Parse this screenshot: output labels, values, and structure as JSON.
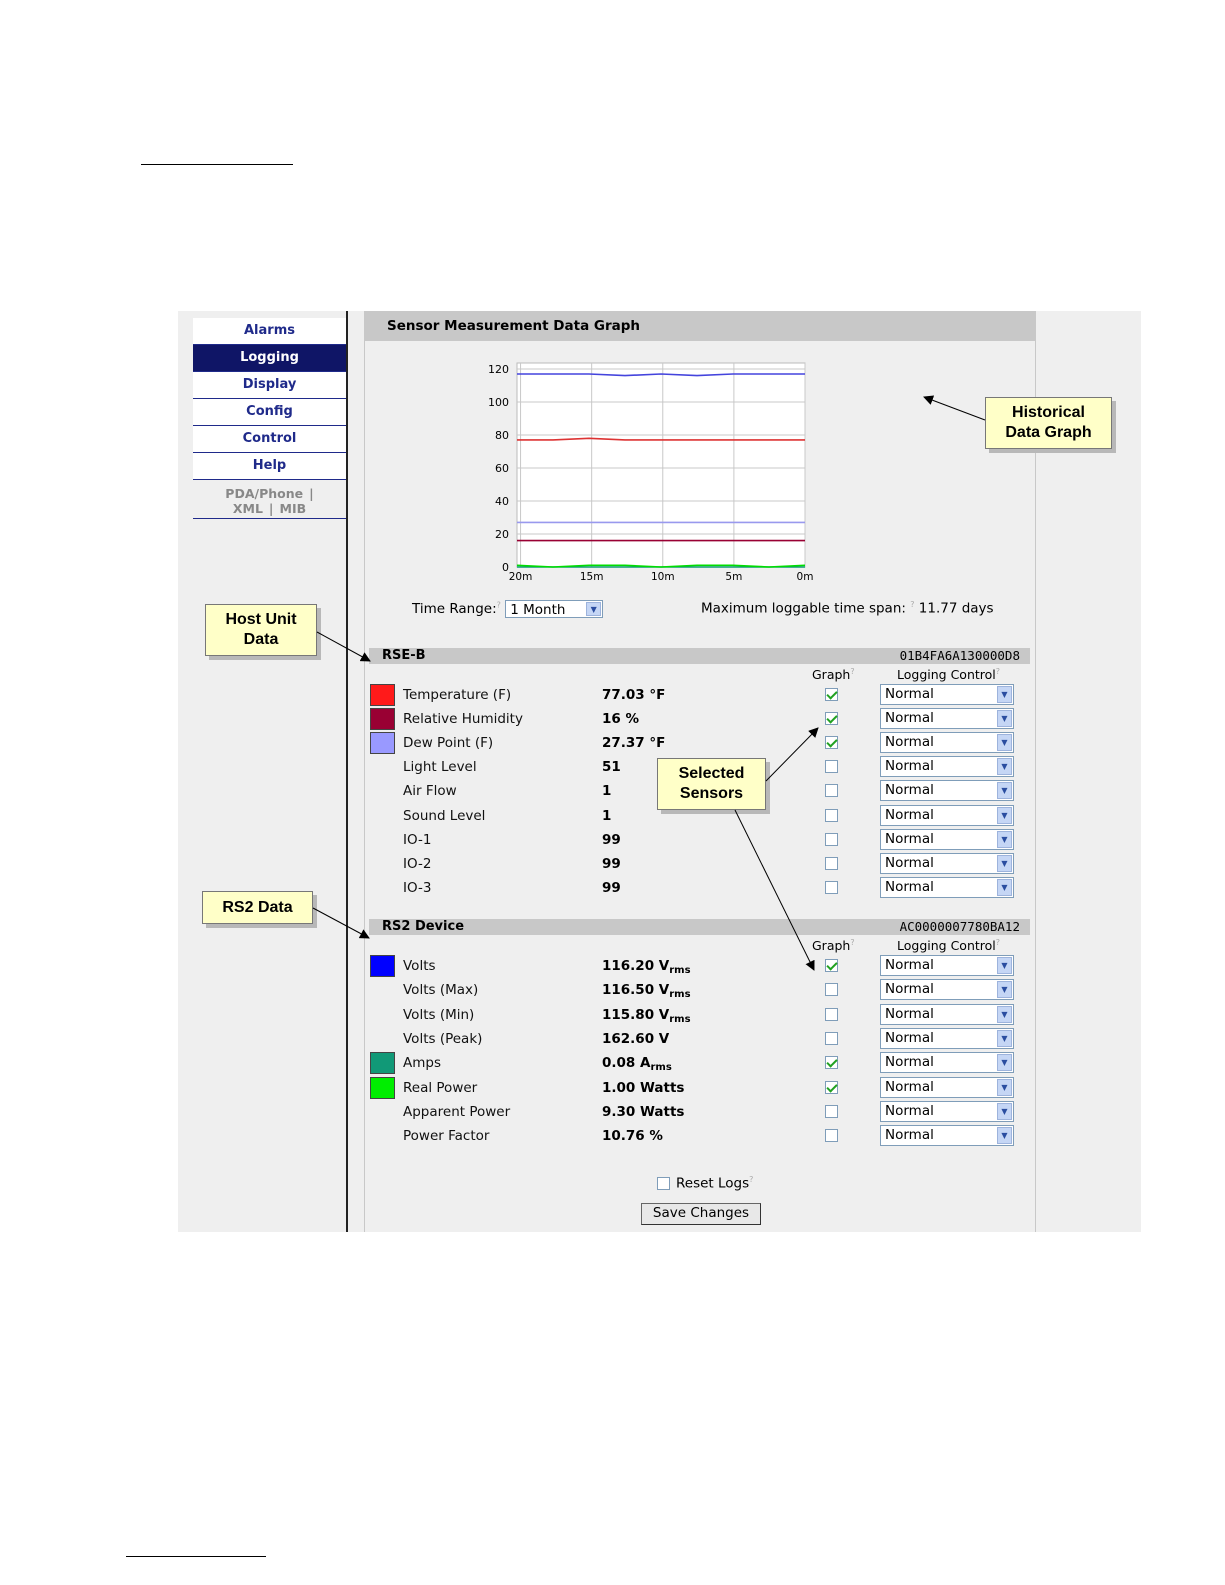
{
  "nav": {
    "items": [
      {
        "label": "Alarms"
      },
      {
        "label": "Logging"
      },
      {
        "label": "Display"
      },
      {
        "label": "Config"
      },
      {
        "label": "Control"
      },
      {
        "label": "Help"
      }
    ],
    "active": "Logging",
    "links": {
      "pda": "PDA/Phone",
      "xml": "XML",
      "mib": "MIB",
      "sep": "|"
    }
  },
  "panel": {
    "title": "Sensor Measurement Data Graph"
  },
  "chart_data": {
    "type": "line",
    "x_ticks": [
      "20m",
      "15m",
      "10m",
      "5m",
      "0m"
    ],
    "y_ticks": [
      "0",
      "20",
      "40",
      "60",
      "80",
      "100",
      "120"
    ],
    "ylim": [
      0,
      120
    ],
    "grid": true,
    "series": [
      {
        "color": "#4444dd",
        "values": [
          117,
          117,
          117,
          116,
          117,
          116,
          117,
          117,
          117
        ]
      },
      {
        "color": "#dd3333",
        "values": [
          77,
          77,
          78,
          77,
          77,
          77,
          77,
          77,
          77
        ]
      },
      {
        "color": "#9999ee",
        "values": [
          27,
          27,
          27,
          27,
          27,
          27,
          27,
          27,
          27
        ]
      },
      {
        "color": "#990033",
        "values": [
          16,
          16,
          16,
          16,
          16,
          16,
          16,
          16,
          16
        ]
      },
      {
        "color": "#119977",
        "values": [
          0,
          0,
          0,
          0,
          0,
          0,
          0,
          0,
          0
        ]
      },
      {
        "color": "#00dd00",
        "values": [
          1,
          0,
          1,
          1,
          0,
          1,
          1,
          0,
          1
        ]
      }
    ]
  },
  "time_range": {
    "label": "Time Range:",
    "q": "?",
    "value": "1 Month"
  },
  "max_span": {
    "label": "Maximum loggable time span:",
    "q": "?",
    "value": "11.77 days"
  },
  "host": {
    "name": "RSE-B",
    "id": "01B4FA6A130000D8",
    "col_graph": "Graph",
    "col_logging": "Logging Control",
    "q": "?",
    "rows": [
      {
        "label": "Temperature (F)",
        "value": "77.03 °F",
        "color": "#ff1a1a",
        "graph": true,
        "control": "Normal"
      },
      {
        "label": "Relative Humidity",
        "value": "16 %",
        "color": "#990033",
        "graph": true,
        "control": "Normal"
      },
      {
        "label": "Dew Point (F)",
        "value": "27.37 °F",
        "color": "#9999ff",
        "graph": true,
        "control": "Normal"
      },
      {
        "label": "Light Level",
        "value": "51",
        "color": "",
        "graph": false,
        "control": "Normal"
      },
      {
        "label": "Air Flow",
        "value": "1",
        "color": "",
        "graph": false,
        "control": "Normal"
      },
      {
        "label": "Sound Level",
        "value": "1",
        "color": "",
        "graph": false,
        "control": "Normal"
      },
      {
        "label": "IO-1",
        "value": "99",
        "color": "",
        "graph": false,
        "control": "Normal"
      },
      {
        "label": "IO-2",
        "value": "99",
        "color": "",
        "graph": false,
        "control": "Normal"
      },
      {
        "label": "IO-3",
        "value": "99",
        "color": "",
        "graph": false,
        "control": "Normal"
      }
    ]
  },
  "rs2": {
    "name": "RS2 Device",
    "id": "AC0000007780BA12",
    "col_graph": "Graph",
    "col_logging": "Logging Control",
    "q": "?",
    "rows": [
      {
        "label": "Volts",
        "value": "116.20 V",
        "unit_sub": "rms",
        "color": "#0000ff",
        "graph": true,
        "control": "Normal"
      },
      {
        "label": "Volts (Max)",
        "value": "116.50 V",
        "unit_sub": "rms",
        "color": "",
        "graph": false,
        "control": "Normal"
      },
      {
        "label": "Volts (Min)",
        "value": "115.80 V",
        "unit_sub": "rms",
        "color": "",
        "graph": false,
        "control": "Normal"
      },
      {
        "label": "Volts (Peak)",
        "value": "162.60 V",
        "unit_sub": "",
        "color": "",
        "graph": false,
        "control": "Normal"
      },
      {
        "label": "Amps",
        "value": "0.08 A",
        "unit_sub": "rms",
        "color": "#119977",
        "graph": true,
        "control": "Normal"
      },
      {
        "label": "Real Power",
        "value": "1.00 Watts",
        "unit_sub": "",
        "color": "#00ee00",
        "graph": true,
        "control": "Normal"
      },
      {
        "label": "Apparent Power",
        "value": "9.30 Watts",
        "unit_sub": "",
        "color": "",
        "graph": false,
        "control": "Normal"
      },
      {
        "label": "Power Factor",
        "value": "10.76 %",
        "unit_sub": "",
        "color": "",
        "graph": false,
        "control": "Normal"
      }
    ]
  },
  "reset_logs": {
    "label": "Reset Logs",
    "q": "?"
  },
  "save_button": "Save Changes",
  "callouts": {
    "historical": [
      "Historical",
      "Data Graph"
    ],
    "host": [
      "Host Unit",
      "Data"
    ],
    "rs2": "RS2 Data",
    "selected": [
      "Selected",
      "Sensors"
    ]
  }
}
